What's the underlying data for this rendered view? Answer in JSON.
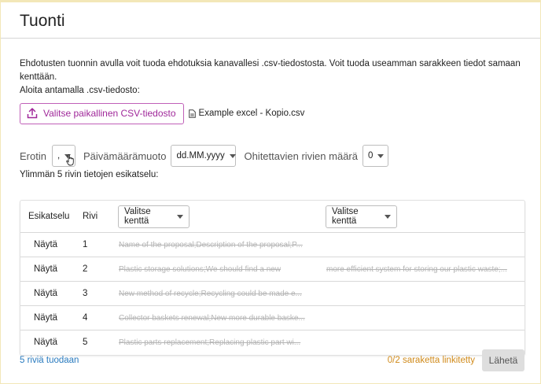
{
  "header": {
    "title": "Tuonti"
  },
  "description": {
    "line1": "Ehdotusten tuonnin avulla voit tuoda ehdotuksia kanavallesi .csv-tiedostosta. Voit tuoda useamman sarakkeen tiedot samaan kenttään.",
    "line2": "Aloita antamalla .csv-tiedosto:"
  },
  "upload": {
    "button_label": "Valitse paikallinen CSV-tiedosto",
    "file_name": "Example excel - Kopio.csv",
    "accent_color": "#a0289a"
  },
  "options": {
    "separator_label": "Erotin",
    "separator_value": ",",
    "date_format_label": "Päivämäärämuoto",
    "date_format_value": "dd.MM.yyyy",
    "skip_rows_label": "Ohitettavien rivien määrä",
    "skip_rows_value": "0"
  },
  "preview_label": "Ylimmän 5 rivin tietojen esikatselu:",
  "table": {
    "headers": {
      "preview": "Esikatselu",
      "row": "Rivi"
    },
    "field_selects": [
      "Valitse kenttä",
      "Valitse kenttä"
    ],
    "rows": [
      {
        "preview": "Näytä",
        "row": "1",
        "col1": "Name of the proposal;Description of the proposal;P...",
        "col2": ""
      },
      {
        "preview": "Näytä",
        "row": "2",
        "col1": "Plastic storage solutions;We should find a new",
        "col2": "more efficient system for storing our plastic waste;..."
      },
      {
        "preview": "Näytä",
        "row": "3",
        "col1": "New method of recycle;Recycling could be made e...",
        "col2": ""
      },
      {
        "preview": "Näytä",
        "row": "4",
        "col1": "Collector baskets renewal;New more durable baske...",
        "col2": ""
      },
      {
        "preview": "Näytä",
        "row": "5",
        "col1": "Plastic parts replacement;Replacing plastic part wi...",
        "col2": ""
      }
    ]
  },
  "footer": {
    "rows_info": "5 riviä tuodaan",
    "linked_info": "0/2 saraketta linkitetty",
    "send_label": "Lähetä"
  }
}
